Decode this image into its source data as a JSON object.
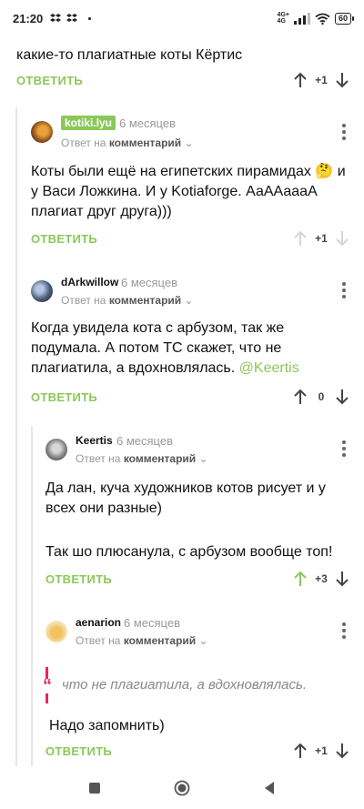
{
  "status_bar": {
    "time": "21:20",
    "network_top": "4G+",
    "network_bottom": "4G",
    "battery": "60"
  },
  "top_comment": {
    "text": "какие-то плагиатные коты Кёртис",
    "reply_label": "ОТВЕТИТЬ",
    "score": "+1"
  },
  "comments": [
    {
      "author": "kotiki.lyu",
      "time": "6 месяцев",
      "reply_to_prefix": "Ответ на",
      "reply_to_target": "комментарий",
      "text": "Коты были ещё на египетских пирамидах 🤔 и у Васи Ложкина. И у Kotiaforge. АаААаааА плагиат друг друга)))",
      "reply_label": "ОТВЕТИТЬ",
      "score": "+1"
    },
    {
      "author": "dArkwillow",
      "time": "6 месяцев",
      "reply_to_prefix": "Ответ на",
      "reply_to_target": "комментарий",
      "text": "Когда увидела кота с арбузом, так же подумала. А потом ТС скажет, что не плагиатила, а вдохновлялась.",
      "mention": "@Keertis",
      "reply_label": "ОТВЕТИТЬ",
      "score": "0"
    },
    {
      "author": "Keertis",
      "time": "6 месяцев",
      "reply_to_prefix": "Ответ на",
      "reply_to_target": "комментарий",
      "text_p1": "Да лан, куча художников котов рисует и у всех они разные)",
      "text_p2": "Так шо плюсанула, с арбузом вообще топ!",
      "reply_label": "ОТВЕТИТЬ",
      "score": "+3"
    },
    {
      "author": "aenarion",
      "time": "6 месяцев",
      "reply_to_prefix": "Ответ на",
      "reply_to_target": "комментарий",
      "quote": "что не плагиатила, а вдохновлялась.",
      "text": "Надо запомнить)",
      "reply_label": "ОТВЕТИТЬ",
      "score": "+1"
    }
  ],
  "colors": {
    "accent": "#8ac858",
    "quote_mark": "#ee2266",
    "muted": "#999999"
  }
}
